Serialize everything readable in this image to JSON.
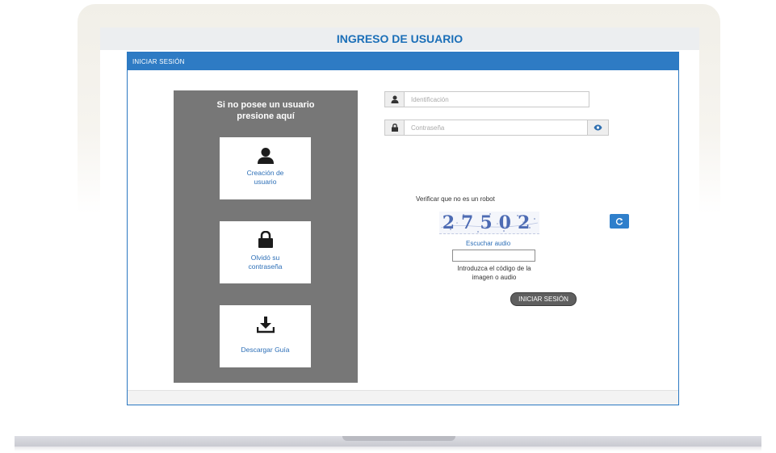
{
  "page": {
    "title": "INGRESO DE USUARIO"
  },
  "panel": {
    "heading": "INICIAR SESIÓN"
  },
  "sidebar": {
    "title_line1": "Si no posee un usuario",
    "title_line2": "presione aquí",
    "actions": [
      {
        "icon": "user-icon",
        "label_line1": "Creación de",
        "label_line2": "usuario"
      },
      {
        "icon": "lock-icon",
        "label_line1": "Olvidó su",
        "label_line2": "contraseña"
      },
      {
        "icon": "download-icon",
        "label_line1": "Descargar Guía",
        "label_line2": ""
      }
    ]
  },
  "login": {
    "id_placeholder": "Identificación",
    "password_placeholder": "Contraseña",
    "id_value": "",
    "password_value": "",
    "verify_label": "Verificar que no es un robot",
    "captcha_text": "27502",
    "audio_link": "Escuchar audio",
    "captcha_value": "",
    "help_line1": "Introduzca el código de la",
    "help_line2": "imagen o audio",
    "submit_label": "INICIAR SESIÓN"
  },
  "colors": {
    "primary": "#2e7bc4",
    "title_blue": "#1b6fb8",
    "sidebar_grey": "#777777",
    "link_blue": "#2d6fb7",
    "button_dark": "#5f5f5f"
  }
}
